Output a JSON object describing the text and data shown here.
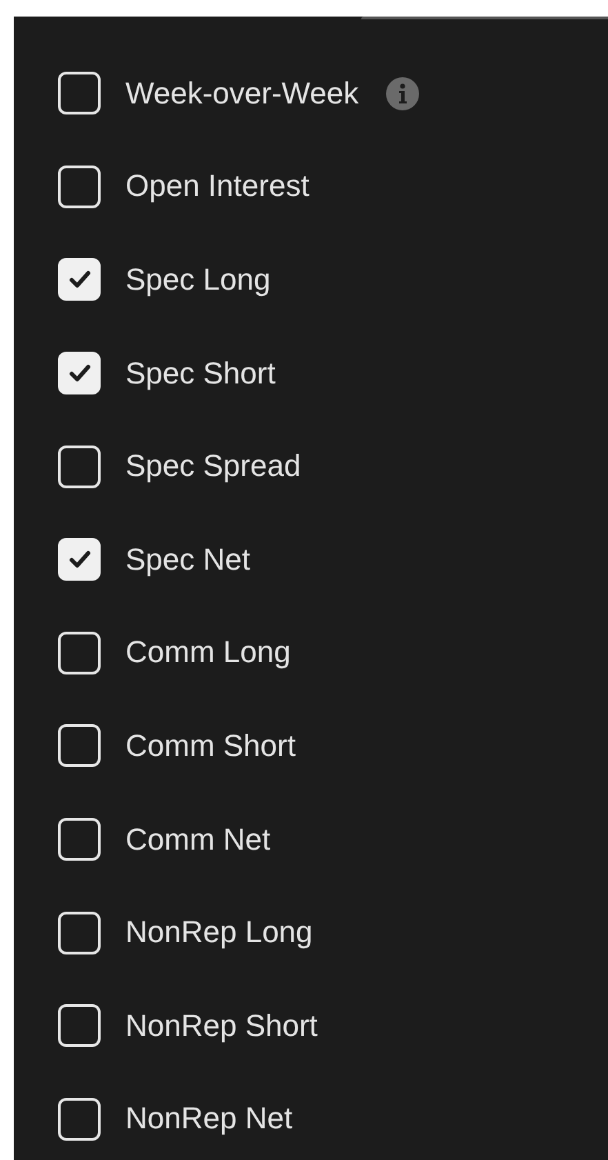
{
  "options": [
    {
      "label": "Week-over-Week",
      "checked": false,
      "info": true
    },
    {
      "label": "Open Interest",
      "checked": false
    },
    {
      "label": "Spec Long",
      "checked": true
    },
    {
      "label": "Spec Short",
      "checked": true
    },
    {
      "label": "Spec Spread",
      "checked": false
    },
    {
      "label": "Spec Net",
      "checked": true
    },
    {
      "label": "Comm Long",
      "checked": false
    },
    {
      "label": "Comm Short",
      "checked": false
    },
    {
      "label": "Comm Net",
      "checked": false
    },
    {
      "label": "NonRep Long",
      "checked": false
    },
    {
      "label": "NonRep Short",
      "checked": false
    },
    {
      "label": "NonRep Net",
      "checked": false
    }
  ]
}
